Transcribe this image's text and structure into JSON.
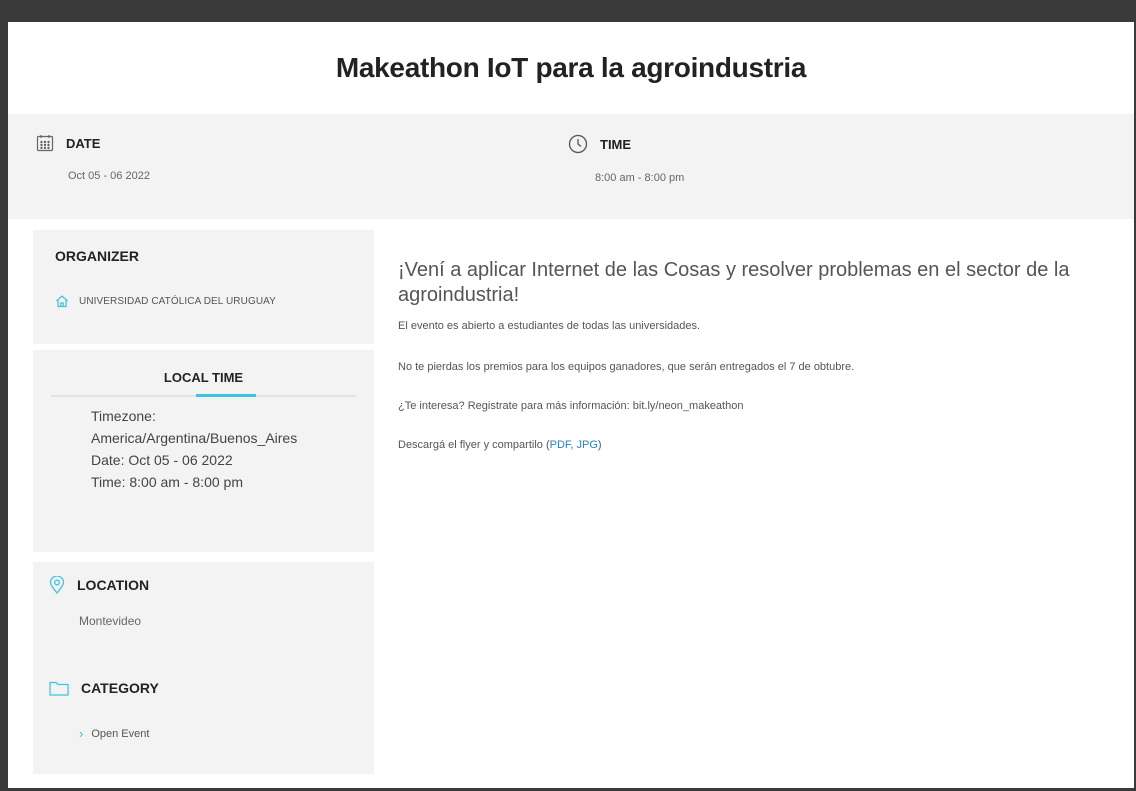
{
  "title": "Makeathon IoT para la agroindustria",
  "date": {
    "label": "DATE",
    "value": "Oct 05 - 06 2022",
    "icon": "calendar-icon"
  },
  "time": {
    "label": "TIME",
    "value": "8:00 am - 8:00 pm",
    "icon": "clock-icon"
  },
  "organizer": {
    "heading": "ORGANIZER",
    "name": "UNIVERSIDAD CATÓLICA DEL URUGUAY",
    "icon": "home-icon"
  },
  "local_time": {
    "heading": "LOCAL TIME",
    "timezone_label": "Timezone:",
    "timezone": "America/Argentina/Buenos_Aires",
    "date": "Date: Oct 05 - 06 2022",
    "time": "Time: 8:00 am - 8:00 pm"
  },
  "location": {
    "heading": "LOCATION",
    "value": "Montevideo",
    "icon": "map-pin-icon"
  },
  "category": {
    "heading": "CATEGORY",
    "item": "Open Event",
    "icon": "folder-icon"
  },
  "description": {
    "lead": "¡Vení a aplicar Internet de las Cosas y resolver problemas en el sector de la agroindustria!",
    "p1": "El evento es abierto a estudiantes de todas las universidades.",
    "p2": "No te pierdas los premios para los equipos ganadores, que serán entregados el 7 de obtubre.",
    "p3": "¿Te interesa? Registrate para más información: bit.ly/neon_makeathon",
    "p4_prefix": "Descargá el flyer y compartilo (",
    "link_pdf": "PDF",
    "sep": ", ",
    "link_jpg": "JPG",
    "p4_suffix": ")"
  },
  "colors": {
    "accent": "#3cc3e0",
    "link": "#2a7fc4",
    "panel": "#f3f3f3"
  }
}
